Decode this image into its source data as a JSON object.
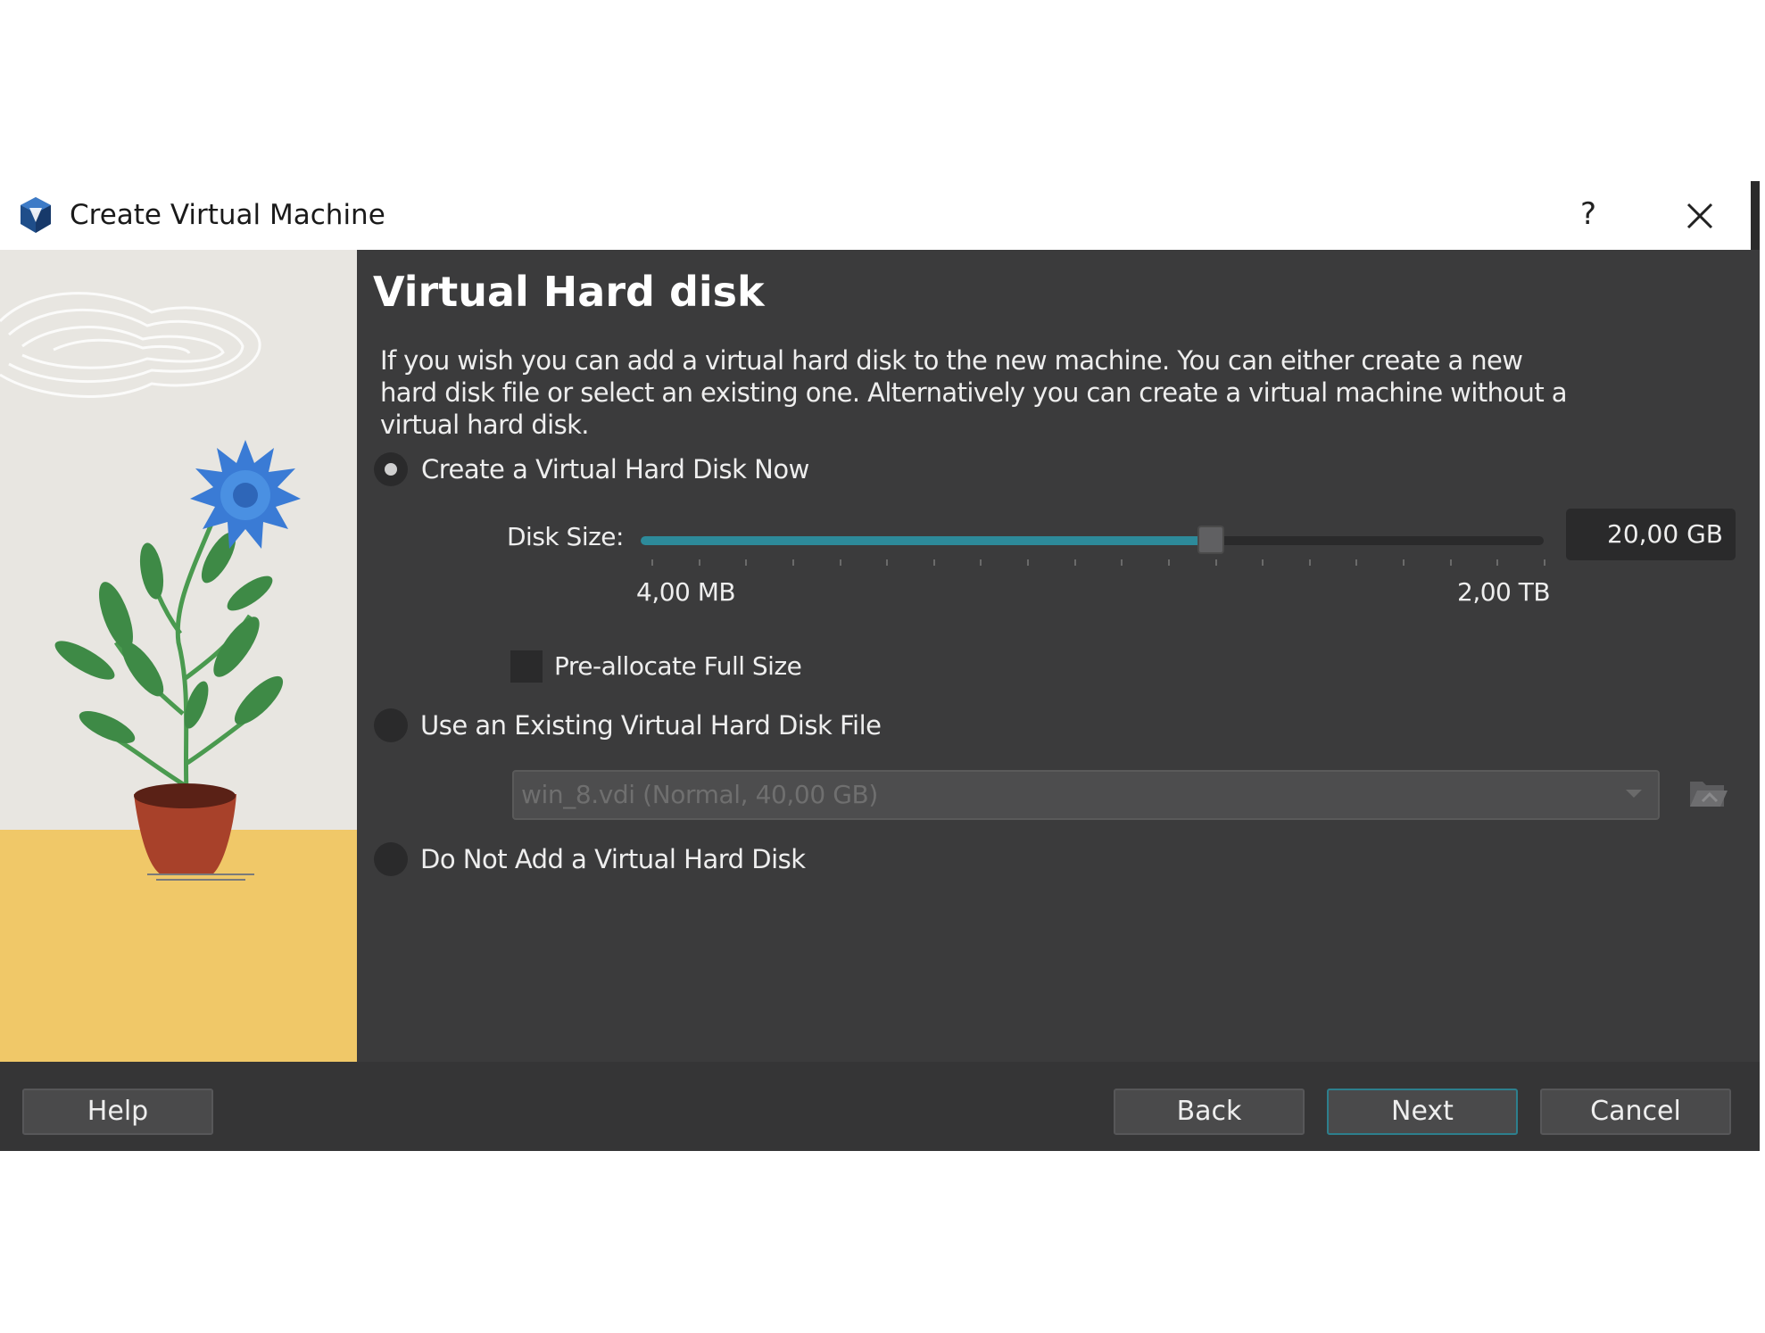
{
  "window": {
    "title": "Create Virtual Machine",
    "help_glyph": "?",
    "icons": [
      "virtualbox-icon",
      "close-icon"
    ]
  },
  "page": {
    "heading": "Virtual Hard disk",
    "description": "If you wish you can add a virtual hard disk to the new machine. You can either create a new hard disk file or select an existing one. Alternatively you can create a virtual machine without a virtual hard disk."
  },
  "options": {
    "create_now": "Create a Virtual Hard Disk Now",
    "use_existing": "Use an Existing Virtual Hard Disk File",
    "no_disk": "Do Not Add a Virtual Hard Disk",
    "selected": "create_now"
  },
  "disk": {
    "size_label": "Disk Size:",
    "min_label": "4,00 MB",
    "max_label": "2,00 TB",
    "value": "20,00 GB",
    "slider_fraction": 0.635,
    "preallocate_label": "Pre-allocate Full Size",
    "preallocate_checked": false
  },
  "existing": {
    "selected_file": "win_8.vdi (Normal, 40,00 GB)",
    "browse_icon": "folder-open-icon"
  },
  "buttons": {
    "help": "Help",
    "back": "Back",
    "next": "Next",
    "cancel": "Cancel"
  },
  "colors": {
    "accent": "#2d8a9a",
    "background": "#3b3b3c"
  }
}
